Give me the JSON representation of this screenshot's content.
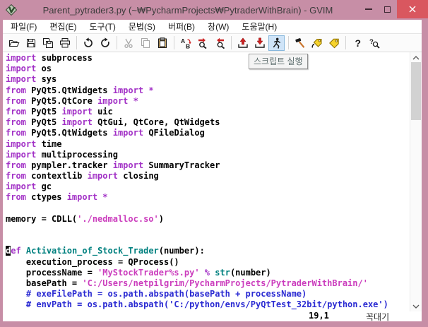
{
  "window": {
    "title": "Parent_pytrader3.py (~₩PycharmProjects₩PytraderWithBrain) - GVIM",
    "controls": {
      "minimize": "minimize",
      "maximize": "maximize",
      "close": "close"
    }
  },
  "menu": {
    "items": [
      {
        "id": "file",
        "label": "파일(F)"
      },
      {
        "id": "edit",
        "label": "편집(E)"
      },
      {
        "id": "tools",
        "label": "도구(T)"
      },
      {
        "id": "syntax",
        "label": "문법(S)"
      },
      {
        "id": "buffers",
        "label": "버퍼(B)"
      },
      {
        "id": "window",
        "label": "창(W)"
      },
      {
        "id": "help",
        "label": "도움말(H)"
      }
    ]
  },
  "toolbar": {
    "tooltip": "스크립트 실행",
    "items": [
      {
        "name": "open"
      },
      {
        "name": "save"
      },
      {
        "name": "save-all"
      },
      {
        "name": "print"
      },
      {
        "sep": true
      },
      {
        "name": "undo"
      },
      {
        "name": "redo"
      },
      {
        "sep": true
      },
      {
        "name": "cut",
        "disabled": true
      },
      {
        "name": "copy",
        "disabled": true
      },
      {
        "name": "paste"
      },
      {
        "sep": true
      },
      {
        "name": "replace"
      },
      {
        "name": "find-next"
      },
      {
        "name": "find-prev"
      },
      {
        "sep": true
      },
      {
        "name": "load-session"
      },
      {
        "name": "save-session"
      },
      {
        "name": "run-script",
        "active": true
      },
      {
        "sep": true
      },
      {
        "name": "make"
      },
      {
        "name": "run-ctags"
      },
      {
        "name": "tag-jump"
      },
      {
        "sep": true
      },
      {
        "name": "help"
      },
      {
        "name": "find-help"
      }
    ]
  },
  "editor": {
    "cursor": {
      "line": 19,
      "col": 1
    },
    "lines": [
      [
        {
          "t": "import",
          "c": "kw"
        },
        {
          "t": " subprocess",
          "c": "pl"
        }
      ],
      [
        {
          "t": "import",
          "c": "kw"
        },
        {
          "t": " os",
          "c": "pl"
        }
      ],
      [
        {
          "t": "import",
          "c": "kw"
        },
        {
          "t": " sys",
          "c": "pl"
        }
      ],
      [
        {
          "t": "from",
          "c": "kw"
        },
        {
          "t": " PyQt5.QtWidgets ",
          "c": "pl"
        },
        {
          "t": "import",
          "c": "kw"
        },
        {
          "t": " ",
          "c": "pl"
        },
        {
          "t": "*",
          "c": "kw"
        }
      ],
      [
        {
          "t": "from",
          "c": "kw"
        },
        {
          "t": " PyQt5.QtCore ",
          "c": "pl"
        },
        {
          "t": "import",
          "c": "kw"
        },
        {
          "t": " ",
          "c": "pl"
        },
        {
          "t": "*",
          "c": "kw"
        }
      ],
      [
        {
          "t": "from",
          "c": "kw"
        },
        {
          "t": " PyQt5 ",
          "c": "pl"
        },
        {
          "t": "import",
          "c": "kw"
        },
        {
          "t": " uic",
          "c": "pl"
        }
      ],
      [
        {
          "t": "from",
          "c": "kw"
        },
        {
          "t": " PyQt5 ",
          "c": "pl"
        },
        {
          "t": "import",
          "c": "kw"
        },
        {
          "t": " QtGui, QtCore, QtWidgets",
          "c": "pl"
        }
      ],
      [
        {
          "t": "from",
          "c": "kw"
        },
        {
          "t": " PyQt5.QtWidgets ",
          "c": "pl"
        },
        {
          "t": "import",
          "c": "kw"
        },
        {
          "t": " QFileDialog",
          "c": "pl"
        }
      ],
      [
        {
          "t": "import",
          "c": "kw"
        },
        {
          "t": " time",
          "c": "pl"
        }
      ],
      [
        {
          "t": "import",
          "c": "kw"
        },
        {
          "t": " multiprocessing",
          "c": "pl"
        }
      ],
      [
        {
          "t": "from",
          "c": "kw"
        },
        {
          "t": " pympler.tracker ",
          "c": "pl"
        },
        {
          "t": "import",
          "c": "kw"
        },
        {
          "t": " SummaryTracker",
          "c": "pl"
        }
      ],
      [
        {
          "t": "from",
          "c": "kw"
        },
        {
          "t": " contextlib ",
          "c": "pl"
        },
        {
          "t": "import",
          "c": "kw"
        },
        {
          "t": " closing",
          "c": "pl"
        }
      ],
      [
        {
          "t": "import",
          "c": "kw"
        },
        {
          "t": " gc",
          "c": "pl"
        }
      ],
      [
        {
          "t": "from",
          "c": "kw"
        },
        {
          "t": " ctypes ",
          "c": "pl"
        },
        {
          "t": "import",
          "c": "kw"
        },
        {
          "t": " ",
          "c": "pl"
        },
        {
          "t": "*",
          "c": "kw"
        }
      ],
      [],
      [
        {
          "t": "memory = CDLL(",
          "c": "pl"
        },
        {
          "t": "'./nedmalloc.so'",
          "c": "str"
        },
        {
          "t": ")",
          "c": "pl"
        }
      ],
      [],
      [],
      [
        {
          "t": "d",
          "c": "kw",
          "cursor": true
        },
        {
          "t": "ef",
          "c": "kw"
        },
        {
          "t": " ",
          "c": "pl"
        },
        {
          "t": "Activation_of_Stock_Trader",
          "c": "id"
        },
        {
          "t": "(number):",
          "c": "pl"
        }
      ],
      [
        {
          "t": "    execution_process = QProcess()",
          "c": "pl"
        }
      ],
      [
        {
          "t": "    processName = ",
          "c": "pl"
        },
        {
          "t": "'MyStockTrader%s.py'",
          "c": "str"
        },
        {
          "t": " ",
          "c": "pl"
        },
        {
          "t": "%",
          "c": "kw"
        },
        {
          "t": " ",
          "c": "pl"
        },
        {
          "t": "str",
          "c": "id"
        },
        {
          "t": "(number)",
          "c": "pl"
        }
      ],
      [
        {
          "t": "    basePath = ",
          "c": "pl"
        },
        {
          "t": "'C:/Users/netpilgrim/PycharmProjects/PytraderWithBrain/'",
          "c": "str"
        }
      ],
      [
        {
          "t": "    # exeFilePath = os.path.abspath(basePath + processName)",
          "c": "com"
        }
      ],
      [
        {
          "t": "    # envPath = os.path.abspath('C:/python/envs/PyQtTest_32bit/python.exe')",
          "c": "com"
        }
      ]
    ],
    "colors": {
      "keyword": "#a231c6",
      "string": "#cb3dbd",
      "comment": "#2a2ad2",
      "identifier": "#00807f",
      "plain": "#000000",
      "background": "#ffffff"
    }
  },
  "statusbar": {
    "ruler": "19,1",
    "scroll_position": "꼭대기"
  },
  "colors": {
    "frame": "#c78ea6",
    "titlebar_text": "#3b3b3b",
    "close_button": "#d9575f",
    "active_button_bg": "#cfe4f8",
    "active_button_border": "#88b7dc",
    "tooltip_bg": "#f4f4f4",
    "tooltip_border": "#8f8f8f",
    "tooltip_text": "#5f6f6f"
  }
}
